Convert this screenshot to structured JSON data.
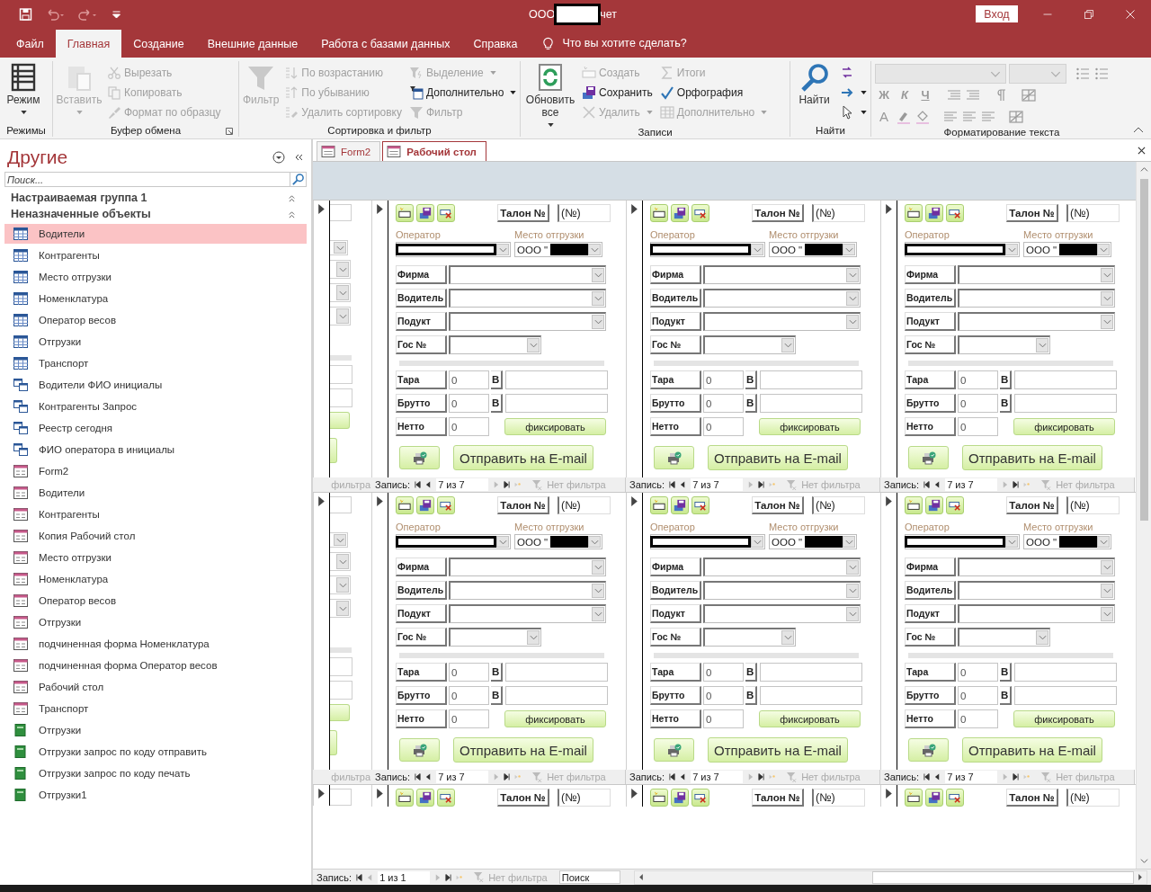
{
  "window": {
    "title_left": "ООО",
    "title_right": "чет",
    "sign_in": "Вход"
  },
  "menu": [
    {
      "label": "Файл",
      "selected": false
    },
    {
      "label": "Главная",
      "selected": true
    },
    {
      "label": "Создание",
      "selected": false
    },
    {
      "label": "Внешние данные",
      "selected": false
    },
    {
      "label": "Работа с базами данных",
      "selected": false
    },
    {
      "label": "Справка",
      "selected": false
    }
  ],
  "tell_me": "Что вы хотите сделать?",
  "ribbon": [
    {
      "title": "Режимы",
      "launcher": false,
      "items": [
        {
          "kind": "large",
          "label": "Режим",
          "disabled": false,
          "dropdown": true
        }
      ]
    },
    {
      "title": "Буфер обмена",
      "launcher": true,
      "items": [
        {
          "kind": "large",
          "label": "Вставить",
          "disabled": true,
          "dropdown": true
        },
        {
          "kind": "small",
          "label": "Вырезать",
          "disabled": true,
          "dropdown": false
        },
        {
          "kind": "small",
          "label": "Копировать",
          "disabled": true,
          "dropdown": false
        },
        {
          "kind": "small",
          "label": "Формат по образцу",
          "disabled": true,
          "dropdown": false
        }
      ]
    },
    {
      "title": "Сортировка и фильтр",
      "launcher": false,
      "items": [
        {
          "kind": "large",
          "label": "Фильтр",
          "disabled": true,
          "dropdown": false
        },
        {
          "kind": "small",
          "label": "По возрастанию",
          "disabled": true,
          "dropdown": false
        },
        {
          "kind": "small",
          "label": "По убыванию",
          "disabled": true,
          "dropdown": false
        },
        {
          "kind": "small",
          "label": "Удалить сортировку",
          "disabled": true,
          "dropdown": false
        },
        {
          "kind": "small",
          "label": "Выделение",
          "disabled": true,
          "dropdown": true
        },
        {
          "kind": "small",
          "label": "Дополнительно",
          "disabled": false,
          "dropdown": true
        },
        {
          "kind": "small",
          "label": "Фильтр",
          "disabled": true,
          "dropdown": false
        }
      ]
    },
    {
      "title": "Записи",
      "launcher": false,
      "items": [
        {
          "kind": "large",
          "label": "Обновить все",
          "disabled": false,
          "dropdown": true
        },
        {
          "kind": "small",
          "label": "Создать",
          "disabled": true,
          "dropdown": false
        },
        {
          "kind": "small",
          "label": "Сохранить",
          "disabled": false,
          "dropdown": false
        },
        {
          "kind": "small",
          "label": "Удалить",
          "disabled": true,
          "dropdown": true
        },
        {
          "kind": "small",
          "label": "Итоги",
          "disabled": true,
          "dropdown": false
        },
        {
          "kind": "small",
          "label": "Орфография",
          "disabled": false,
          "dropdown": false
        },
        {
          "kind": "small",
          "label": "Дополнительно",
          "disabled": true,
          "dropdown": true
        }
      ]
    },
    {
      "title": "Найти",
      "launcher": false,
      "items": [
        {
          "kind": "large",
          "label": "Найти",
          "disabled": false,
          "dropdown": false
        },
        {
          "kind": "icon",
          "disabled": false,
          "dropdown": false
        },
        {
          "kind": "icon",
          "disabled": false,
          "dropdown": true
        },
        {
          "kind": "icon",
          "disabled": false,
          "dropdown": true
        }
      ]
    }
  ],
  "formatting": {
    "title": "Форматирование текста",
    "bold": "Ж",
    "italic": "К",
    "underline": "Ч",
    "font_color": "A"
  },
  "nav_pane": {
    "title": "Другие",
    "search_placeholder": "Поиск...",
    "groups": [
      {
        "label": "Настраиваемая группа 1",
        "expanded": true
      },
      {
        "label": "Неназначенные объекты",
        "expanded": true,
        "items": [
          {
            "label": "Водители",
            "kind": "table",
            "selected": true
          },
          {
            "label": "Контрагенты",
            "kind": "table",
            "selected": false
          },
          {
            "label": "Место отгрузки",
            "kind": "table",
            "selected": false
          },
          {
            "label": "Номенклатура",
            "kind": "table",
            "selected": false
          },
          {
            "label": "Оператор весов",
            "kind": "table",
            "selected": false
          },
          {
            "label": "Отгрузки",
            "kind": "table",
            "selected": false
          },
          {
            "label": "Транспорт",
            "kind": "table",
            "selected": false
          },
          {
            "label": "Водители ФИО инициалы",
            "kind": "query",
            "selected": false
          },
          {
            "label": "Контрагенты Запрос",
            "kind": "query",
            "selected": false
          },
          {
            "label": "Реестр сегодня",
            "kind": "query",
            "selected": false
          },
          {
            "label": "ФИО оператора в инициалы",
            "kind": "query",
            "selected": false
          },
          {
            "label": "Form2",
            "kind": "form",
            "selected": false
          },
          {
            "label": "Водители",
            "kind": "form",
            "selected": false
          },
          {
            "label": "Контрагенты",
            "kind": "form",
            "selected": false
          },
          {
            "label": "Копия Рабочий стол",
            "kind": "form",
            "selected": false
          },
          {
            "label": "Место отгрузки",
            "kind": "form",
            "selected": false
          },
          {
            "label": "Номенклатура",
            "kind": "form",
            "selected": false
          },
          {
            "label": "Оператор весов",
            "kind": "form",
            "selected": false
          },
          {
            "label": "Отгрузки",
            "kind": "form",
            "selected": false
          },
          {
            "label": "подчиненная форма Номенклатура",
            "kind": "form",
            "selected": false
          },
          {
            "label": "подчиненная форма Оператор весов",
            "kind": "form",
            "selected": false
          },
          {
            "label": "Рабочий стол",
            "kind": "form",
            "selected": false
          },
          {
            "label": "Транспорт",
            "kind": "form",
            "selected": false
          },
          {
            "label": "Отгрузки",
            "kind": "report",
            "selected": false
          },
          {
            "label": "Отгрузки запрос по коду отправить",
            "kind": "report",
            "selected": false
          },
          {
            "label": "Отгрузки запрос по коду печать",
            "kind": "report",
            "selected": false
          },
          {
            "label": "Отгрузки1",
            "kind": "report",
            "selected": false
          }
        ]
      }
    ]
  },
  "document": {
    "tabs": [
      {
        "label": "Form2",
        "selected": false
      },
      {
        "label": "Рабочий стол",
        "selected": true
      }
    ],
    "rows": [
      {
        "left": {
          "filter_tail": "фильтра"
        },
        "panels": [
          {
            "talon_label": "Талон №",
            "talon_value": "(№)",
            "operator_label": "Оператор",
            "place_label": "Место отгрузки",
            "place_value": "ООО \"",
            "fields": [
              {
                "label": "Фирма",
                "kind": "combo"
              },
              {
                "label": "Водитель",
                "kind": "combo"
              },
              {
                "label": "Подукт",
                "kind": "combo"
              },
              {
                "label": "Гос №",
                "kind": "short"
              }
            ],
            "weights": [
              {
                "label": "Тара",
                "value": "0",
                "kind": "weight",
                "unit": "В"
              },
              {
                "label": "Брутто",
                "value": "0",
                "kind": "weight",
                "unit": "В"
              },
              {
                "label": "Нетто",
                "value": "0",
                "kind": "net",
                "action": "фиксировать"
              }
            ],
            "email": "Отправить на E-mail",
            "nav": {
              "label": "Запись:",
              "position": "7 из 7",
              "filter": "Нет фильтра"
            }
          },
          {
            "talon_label": "Талон №",
            "talon_value": "(№)",
            "operator_label": "Оператор",
            "place_label": "Место отгрузки",
            "place_value": "ООО \"",
            "fields": [
              {
                "label": "Фирма",
                "kind": "combo"
              },
              {
                "label": "Водитель",
                "kind": "combo"
              },
              {
                "label": "Подукт",
                "kind": "combo"
              },
              {
                "label": "Гос №",
                "kind": "short"
              }
            ],
            "weights": [
              {
                "label": "Тара",
                "value": "0",
                "kind": "weight",
                "unit": "В"
              },
              {
                "label": "Брутто",
                "value": "0",
                "kind": "weight",
                "unit": "В"
              },
              {
                "label": "Нетто",
                "value": "0",
                "kind": "net",
                "action": "фиксировать"
              }
            ],
            "email": "Отправить на E-mail",
            "nav": {
              "label": "Запись:",
              "position": "7 из 7",
              "filter": "Нет фильтра"
            }
          },
          {
            "talon_label": "Талон №",
            "talon_value": "(№)",
            "operator_label": "Оператор",
            "place_label": "Место отгрузки",
            "place_value": "ООО \"",
            "fields": [
              {
                "label": "Фирма",
                "kind": "combo"
              },
              {
                "label": "Водитель",
                "kind": "combo"
              },
              {
                "label": "Подукт",
                "kind": "combo"
              },
              {
                "label": "Гос №",
                "kind": "short"
              }
            ],
            "weights": [
              {
                "label": "Тара",
                "value": "0",
                "kind": "weight",
                "unit": "В"
              },
              {
                "label": "Брутто",
                "value": "0",
                "kind": "weight",
                "unit": "В"
              },
              {
                "label": "Нетто",
                "value": "0",
                "kind": "net",
                "action": "фиксировать"
              }
            ],
            "email": "Отправить на E-mail",
            "nav": {
              "label": "Запись:",
              "position": "7 из 7",
              "filter": "Нет фильтра"
            }
          }
        ]
      },
      {
        "left": {
          "filter_tail": "фильтра"
        },
        "panels": [
          {
            "talon_label": "Талон №",
            "talon_value": "(№)",
            "operator_label": "Оператор",
            "place_label": "Место отгрузки",
            "place_value": "ООО \"",
            "fields": [
              {
                "label": "Фирма",
                "kind": "combo"
              },
              {
                "label": "Водитель",
                "kind": "combo"
              },
              {
                "label": "Подукт",
                "kind": "combo"
              },
              {
                "label": "Гос №",
                "kind": "short"
              }
            ],
            "weights": [
              {
                "label": "Тара",
                "value": "0",
                "kind": "weight",
                "unit": "В"
              },
              {
                "label": "Брутто",
                "value": "0",
                "kind": "weight",
                "unit": "В"
              },
              {
                "label": "Нетто",
                "value": "0",
                "kind": "net",
                "action": "фиксировать"
              }
            ],
            "email": "Отправить на E-mail",
            "nav": {
              "label": "Запись:",
              "position": "7 из 7",
              "filter": "Нет фильтра"
            }
          },
          {
            "talon_label": "Талон №",
            "talon_value": "(№)",
            "operator_label": "Оператор",
            "place_label": "Место отгрузки",
            "place_value": "ООО \"",
            "fields": [
              {
                "label": "Фирма",
                "kind": "combo"
              },
              {
                "label": "Водитель",
                "kind": "combo"
              },
              {
                "label": "Подукт",
                "kind": "combo"
              },
              {
                "label": "Гос №",
                "kind": "short"
              }
            ],
            "weights": [
              {
                "label": "Тара",
                "value": "0",
                "kind": "weight",
                "unit": "В"
              },
              {
                "label": "Брутто",
                "value": "0",
                "kind": "weight",
                "unit": "В"
              },
              {
                "label": "Нетто",
                "value": "0",
                "kind": "net",
                "action": "фиксировать"
              }
            ],
            "email": "Отправить на E-mail",
            "nav": {
              "label": "Запись:",
              "position": "7 из 7",
              "filter": "Нет фильтра"
            }
          },
          {
            "talon_label": "Талон №",
            "talon_value": "(№)",
            "operator_label": "Оператор",
            "place_label": "Место отгрузки",
            "place_value": "ООО \"",
            "fields": [
              {
                "label": "Фирма",
                "kind": "combo"
              },
              {
                "label": "Водитель",
                "kind": "combo"
              },
              {
                "label": "Подукт",
                "kind": "combo"
              },
              {
                "label": "Гос №",
                "kind": "short"
              }
            ],
            "weights": [
              {
                "label": "Тара",
                "value": "0",
                "kind": "weight",
                "unit": "В"
              },
              {
                "label": "Брутто",
                "value": "0",
                "kind": "weight",
                "unit": "В"
              },
              {
                "label": "Нетто",
                "value": "0",
                "kind": "net",
                "action": "фиксировать"
              }
            ],
            "email": "Отправить на E-mail",
            "nav": {
              "label": "Запись:",
              "position": "7 из 7",
              "filter": "Нет фильтра"
            }
          }
        ]
      }
    ],
    "partial_row": [
      {
        "talon_label": "Талон №",
        "talon_value": "(№)"
      },
      {
        "talon_label": "Талон №",
        "talon_value": "(№)"
      },
      {
        "talon_label": "Талон №",
        "talon_value": "(№)"
      }
    ]
  },
  "status_bar": {
    "label": "Запись:",
    "position": "1 из 1",
    "filter": "Нет фильтра",
    "search_placeholder": "Поиск"
  }
}
